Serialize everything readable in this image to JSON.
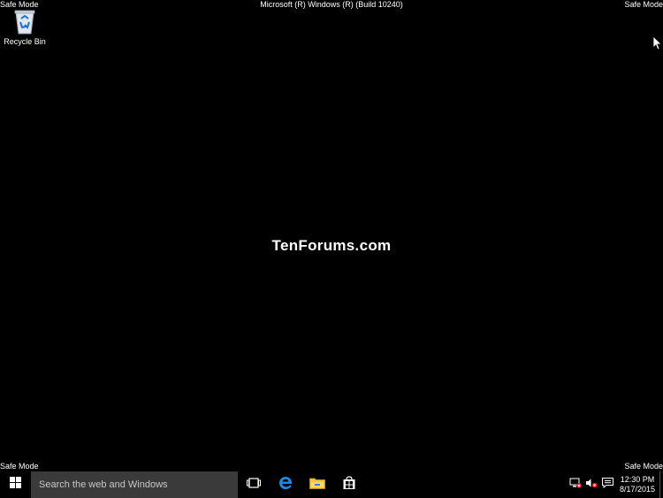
{
  "desktop": {
    "safe_mode_label": "Safe Mode",
    "os_build_text": "Microsoft (R) Windows (R) (Build 10240)",
    "watermark": "TenForums.com",
    "icons": [
      {
        "label": "Recycle Bin",
        "icon": "recycle-bin-icon"
      }
    ]
  },
  "taskbar": {
    "search": {
      "placeholder": "Search the web and Windows",
      "value": ""
    },
    "pinned": [
      {
        "name": "task-view",
        "icon": "task-view-icon"
      },
      {
        "name": "edge",
        "icon": "edge-icon"
      },
      {
        "name": "file-explorer",
        "icon": "file-explorer-icon"
      },
      {
        "name": "store",
        "icon": "store-icon"
      }
    ],
    "tray": {
      "time": "12:30 PM",
      "date": "8/17/2015",
      "icons": [
        "network-disconnected-icon",
        "volume-muted-icon",
        "action-center-icon"
      ]
    }
  },
  "colors": {
    "background": "#000000",
    "search_box": "#3a3a3a",
    "edge_blue": "#1e88e5",
    "folder_yellow": "#f4c542",
    "error_red": "#e81123"
  }
}
